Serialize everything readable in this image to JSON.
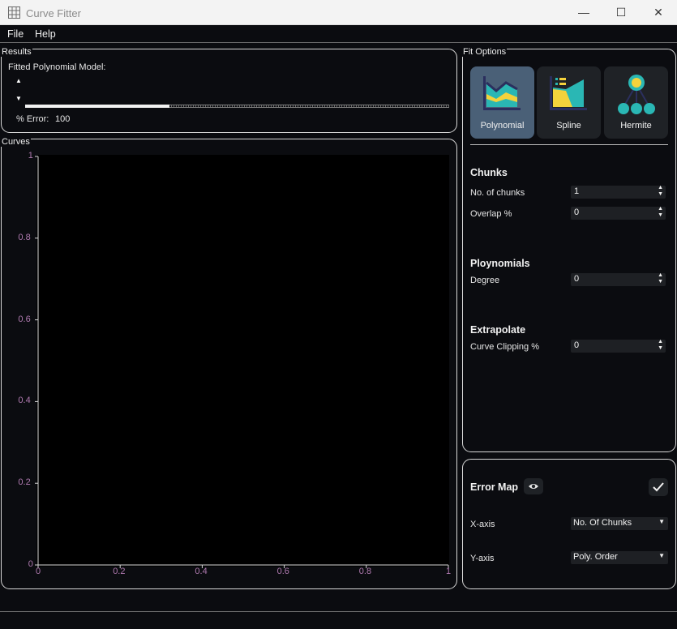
{
  "window": {
    "title": "Curve Fitter",
    "icon": "grid-table-icon",
    "controls": {
      "minimize": "—",
      "maximize": "☐",
      "close": "✕"
    }
  },
  "menu": {
    "file": "File",
    "help": "Help"
  },
  "results": {
    "group_title": "Results",
    "model_label": "Fitted Polynomial Model:",
    "up_arrow": "▲",
    "down_arrow": "▼",
    "slider_value_fraction": 0.34,
    "error_label": "% Error:",
    "error_value": "100"
  },
  "curves": {
    "group_title": "Curves"
  },
  "chart_data": {
    "type": "line",
    "title": "",
    "xlabel": "",
    "ylabel": "",
    "xlim": [
      0,
      1
    ],
    "ylim": [
      0,
      1
    ],
    "x_ticks": [
      "0",
      "0.2",
      "0.4",
      "0.6",
      "0.8",
      "1"
    ],
    "y_ticks": [
      "0",
      "0.2",
      "0.4",
      "0.6",
      "0.8",
      "1"
    ],
    "series": [],
    "grid": false,
    "background": "#000000",
    "axis_color": "#d8d8d8",
    "tick_label_color": "#b07ab0"
  },
  "fit_options": {
    "group_title": "Fit Options",
    "buttons": [
      {
        "label": "Polynomial",
        "icon": "polynomial-chart-icon",
        "selected": true
      },
      {
        "label": "Spline",
        "icon": "spline-chart-icon",
        "selected": false
      },
      {
        "label": "Hermite",
        "icon": "hermite-tree-icon",
        "selected": false
      }
    ],
    "chunks": {
      "title": "Chunks",
      "no_of_chunks_label": "No. of chunks",
      "no_of_chunks_value": "1",
      "overlap_label": "Overlap %",
      "overlap_value": "0"
    },
    "polynomials": {
      "title": "Ploynomials",
      "degree_label": "Degree",
      "degree_value": "0"
    },
    "extrapolate": {
      "title": "Extrapolate",
      "clipping_label": "Curve Clipping %",
      "clipping_value": "0"
    },
    "spin_arrows": "▲▼"
  },
  "error_map": {
    "title": "Error Map",
    "eye_icon": "eye-icon",
    "check_icon": "checkmark-icon",
    "x_axis_label": "X-axis",
    "x_axis_value": "No. Of Chunks",
    "y_axis_label": "Y-axis",
    "y_axis_value": "Poly. Order",
    "dropdown_arrow": "▼"
  },
  "colors": {
    "background": "#0b0c10",
    "selected_button": "#4a6077",
    "teal": "#2ab7b4",
    "yellow": "#f4d23c",
    "navy": "#2b2f5e"
  }
}
